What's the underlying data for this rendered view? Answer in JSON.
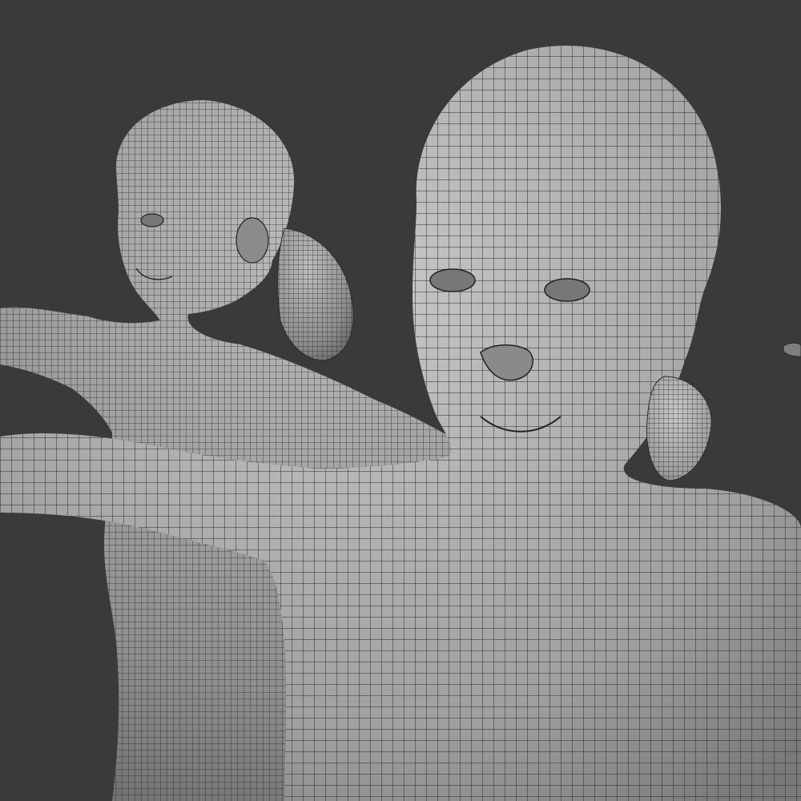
{
  "viewport": {
    "background_color": "#3a3a3a"
  },
  "scene": {
    "mesh_fill_color": "#8e8e8e",
    "mesh_highlight_color": "#b9b9b9",
    "wireframe_color": "#2a2a2a",
    "figures": [
      {
        "id": "figure-back"
      },
      {
        "id": "figure-front"
      }
    ],
    "partial_object_right_edge": {
      "present": true
    }
  }
}
